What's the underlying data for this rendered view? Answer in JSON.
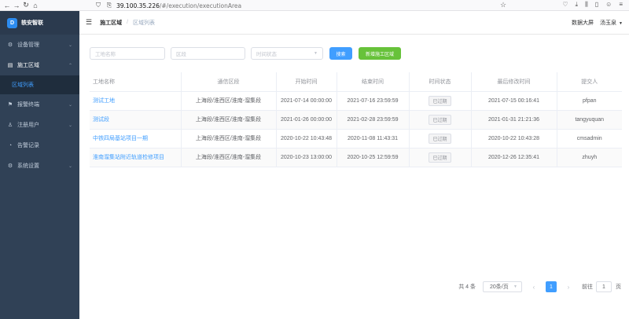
{
  "browser": {
    "url_host": "39.100.35.226",
    "url_path": "/#/execution/executionArea"
  },
  "brand": {
    "name": "轶安智联",
    "logo_text": "D"
  },
  "sidebar": {
    "items": [
      {
        "label": "设备管理",
        "icon": "device-icon",
        "expandable": true
      },
      {
        "label": "施工区域",
        "icon": "area-icon",
        "expandable": true,
        "active": true
      },
      {
        "label": "区域列表",
        "sub": true,
        "selected": true
      },
      {
        "label": "报警终端",
        "icon": "alarm-icon",
        "expandable": true
      },
      {
        "label": "注册用户",
        "icon": "user-icon",
        "expandable": true
      },
      {
        "label": "告警记录",
        "icon": "record-icon",
        "expandable": false
      },
      {
        "label": "系统设置",
        "icon": "settings-icon",
        "expandable": true
      }
    ]
  },
  "header": {
    "breadcrumb": [
      "施工区域",
      "区域列表"
    ],
    "data_screen": "数据大屏",
    "user_name": "汤玉泉"
  },
  "filters": {
    "name_placeholder": "工地名称",
    "segment_placeholder": "区段",
    "time_status_placeholder": "时间状态",
    "search_label": "搜索",
    "new_label": "新增施工区域"
  },
  "table": {
    "headers": [
      "工地名称",
      "通信区段",
      "开始时间",
      "结束时间",
      "时间状态",
      "最后修改时间",
      "提交人"
    ],
    "rows": [
      {
        "name": "测试工地",
        "segment": "上海段/淮西区/淮南-溜集段",
        "start": "2021-07-14 00:00:00",
        "end": "2021-07-16 23:59:59",
        "status": "已过期",
        "modified": "2021-07-15 00:16:41",
        "submitter": "pfpan"
      },
      {
        "name": "测试段",
        "segment": "上海段/淮西区/淮南-溜集段",
        "start": "2021-01-26 00:00:00",
        "end": "2021-02-28 23:59:59",
        "status": "已过期",
        "modified": "2021-01-31 21:21:36",
        "submitter": "tangyuquan"
      },
      {
        "name": "中铁四局基站项目一期",
        "segment": "上海段/淮西区/淮南-溜集段",
        "start": "2020-10-22 10:43:48",
        "end": "2020-11-08 11:43:31",
        "status": "已过期",
        "modified": "2020-10-22 10:43:28",
        "submitter": "cmsadmin"
      },
      {
        "name": "淮南溜集站附近轨道检修项目",
        "segment": "上海段/淮西区/淮南-溜集段",
        "start": "2020-10-23 13:00:00",
        "end": "2020-10-25 12:59:59",
        "status": "已过期",
        "modified": "2020-12-26 12:35:41",
        "submitter": "zhuyh"
      }
    ]
  },
  "pagination": {
    "total": "共 4 条",
    "page_size": "20条/页",
    "current_page": "1",
    "jump_label": "前往",
    "jump_value": "1",
    "jump_unit": "页"
  },
  "colors": {
    "primary": "#409eff",
    "success": "#67c23a",
    "sidebar_bg": "#304156"
  }
}
